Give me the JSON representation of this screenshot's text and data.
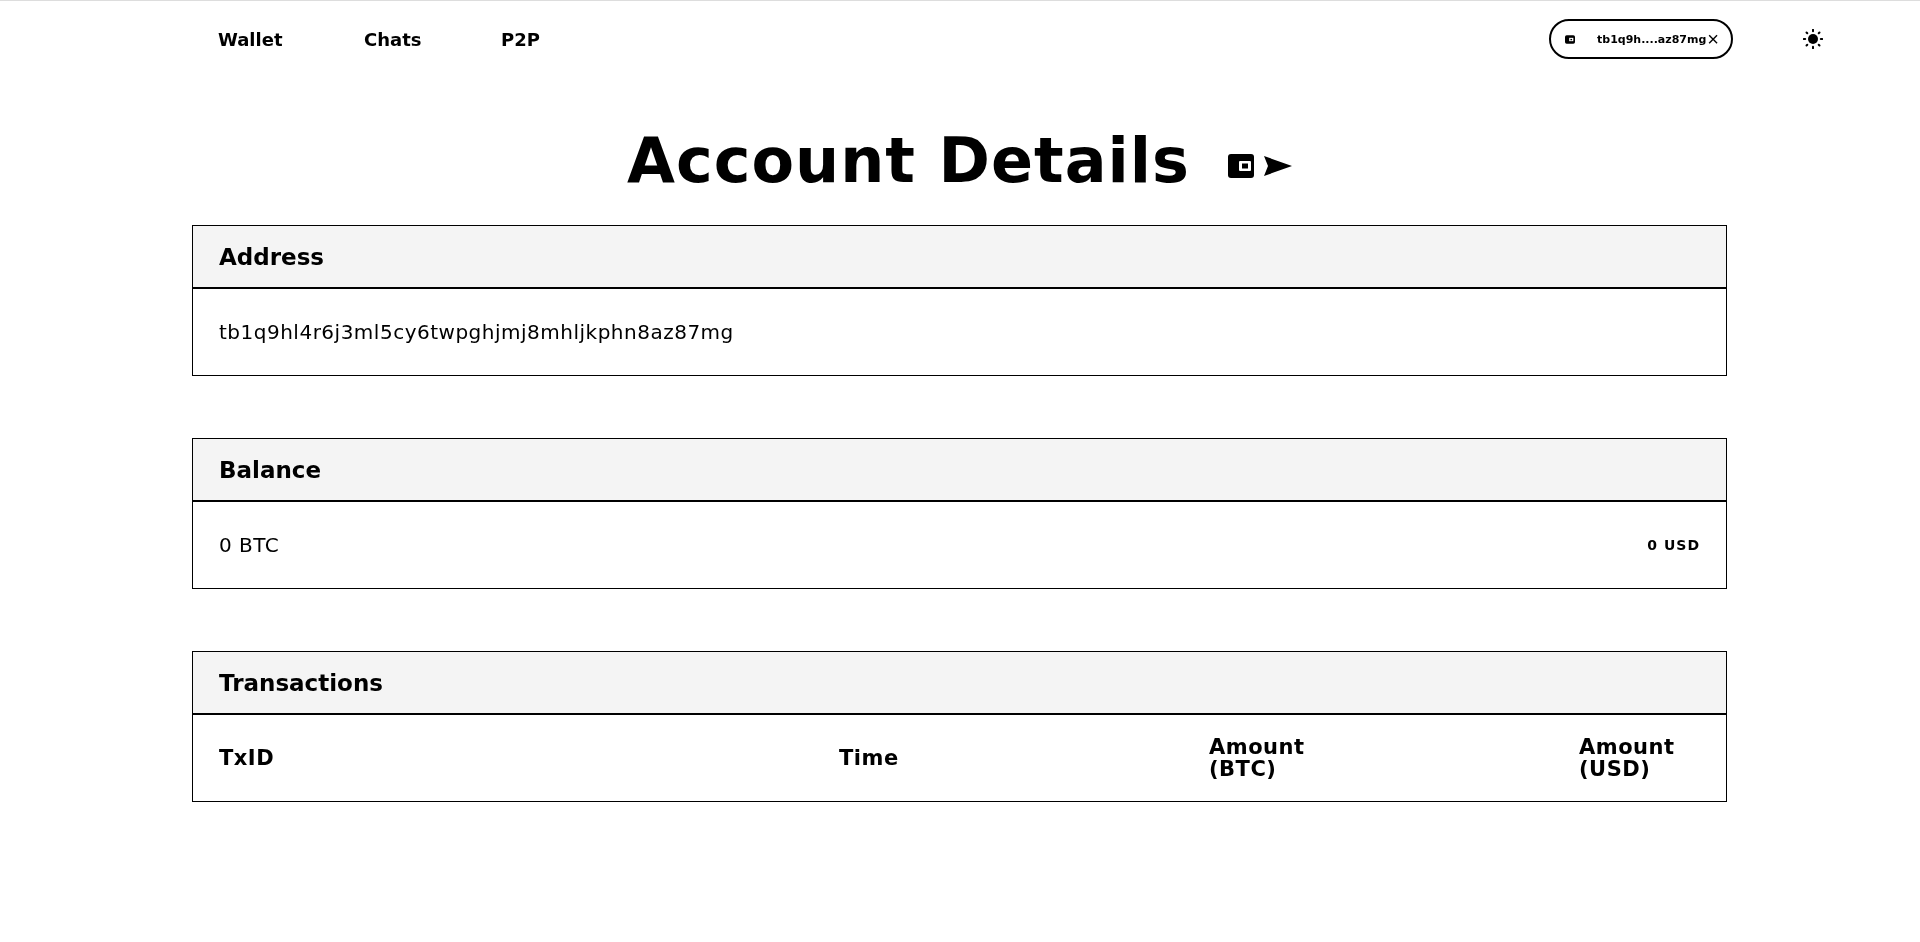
{
  "nav": {
    "items": [
      {
        "label": "Wallet"
      },
      {
        "label": "Chats"
      },
      {
        "label": "P2P"
      }
    ],
    "account_pill": {
      "address": "tb1q9h....az87mg",
      "close": "×"
    }
  },
  "page_title": "Account Details",
  "address_card": {
    "title": "Address",
    "value": "tb1q9hl4r6j3ml5cy6twpghjmj8mhljkphn8az87mg"
  },
  "balance_card": {
    "title": "Balance",
    "btc": "0 BTC",
    "usd": "0 USD"
  },
  "transactions_card": {
    "title": "Transactions",
    "columns": [
      "TxID",
      "Time",
      "Amount\n(BTC)",
      "Amount\n(USD)"
    ]
  }
}
